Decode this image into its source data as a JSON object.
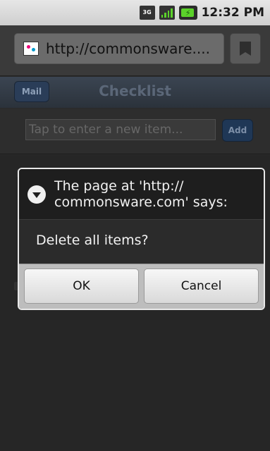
{
  "status_bar": {
    "network_label": "3G",
    "battery_icon": "battery-charging-icon",
    "time": "12:32 PM"
  },
  "browser": {
    "url": "http://commonsware....",
    "bookmark_icon": "bookmark-icon"
  },
  "app": {
    "header": {
      "mail_label": "Mail",
      "title": "Checklist"
    },
    "new_item": {
      "placeholder": "Tap to enter a new item...",
      "add_label": "Add"
    }
  },
  "dialog": {
    "title": "The page at 'http:// commonsware.com' says:",
    "message": "Delete all items?",
    "ok_label": "OK",
    "cancel_label": "Cancel"
  }
}
